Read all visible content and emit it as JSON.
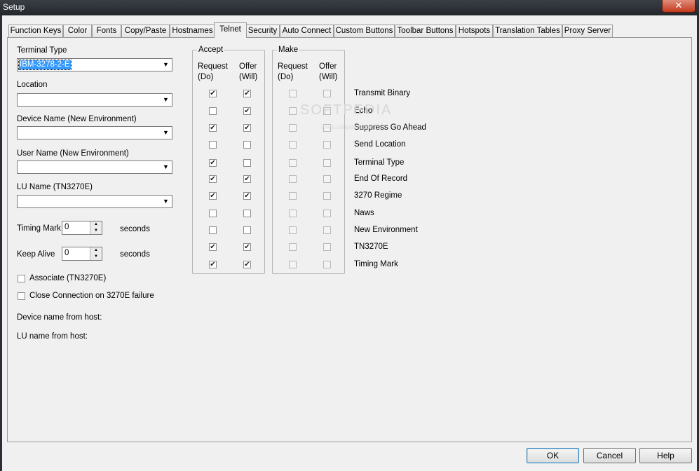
{
  "window": {
    "title": "Setup",
    "close_glyph": "✕"
  },
  "tabs": [
    {
      "label": "Function Keys"
    },
    {
      "label": "Color"
    },
    {
      "label": "Fonts"
    },
    {
      "label": "Copy/Paste"
    },
    {
      "label": "Hostnames"
    },
    {
      "label": "Telnet",
      "active": true
    },
    {
      "label": "Security"
    },
    {
      "label": "Auto Connect"
    },
    {
      "label": "Custom Buttons"
    },
    {
      "label": "Toolbar Buttons"
    },
    {
      "label": "Hotspots"
    },
    {
      "label": "Translation Tables"
    },
    {
      "label": "Proxy Server"
    }
  ],
  "left_form": {
    "terminal_type": {
      "label": "Terminal Type",
      "value": "IBM-3278-2-E"
    },
    "location": {
      "label": "Location",
      "value": ""
    },
    "device_name": {
      "label": "Device Name (New Environment)",
      "value": ""
    },
    "user_name": {
      "label": "User Name (New Environment)",
      "value": ""
    },
    "lu_name": {
      "label": "LU Name (TN3270E)",
      "value": ""
    },
    "timing_mark": {
      "label": "Timing Mark",
      "value": "0",
      "unit": "seconds"
    },
    "keep_alive": {
      "label": "Keep Alive",
      "value": "0",
      "unit": "seconds"
    },
    "associate": {
      "label": "Associate (TN3270E)",
      "checked": false
    },
    "close_connection": {
      "label": "Close Connection on 3270E failure",
      "checked": false
    },
    "device_name_from_host": {
      "label": "Device name from host:"
    },
    "lu_name_from_host": {
      "label": "LU name from host:"
    }
  },
  "options": {
    "accept": {
      "title": "Accept",
      "col1_line1": "Request",
      "col1_line2": "(Do)",
      "col2_line1": "Offer",
      "col2_line2": "(Will)"
    },
    "make": {
      "title": "Make",
      "col1_line1": "Request",
      "col1_line2": "(Do)",
      "col2_line1": "Offer",
      "col2_line2": "(Will)"
    },
    "rows": [
      {
        "label": "Transmit Binary",
        "accept_do": true,
        "accept_will": true,
        "make_do": false,
        "make_will": false
      },
      {
        "label": "Echo",
        "accept_do": false,
        "accept_will": true,
        "make_do": false,
        "make_will": false
      },
      {
        "label": "Suppress Go Ahead",
        "accept_do": true,
        "accept_will": true,
        "make_do": false,
        "make_will": false
      },
      {
        "label": "Send Location",
        "accept_do": false,
        "accept_will": false,
        "make_do": false,
        "make_will": false
      },
      {
        "label": "Terminal Type",
        "accept_do": true,
        "accept_will": false,
        "make_do": false,
        "make_will": false
      },
      {
        "label": "End Of Record",
        "accept_do": true,
        "accept_will": true,
        "make_do": false,
        "make_will": false
      },
      {
        "label": "3270 Regime",
        "accept_do": true,
        "accept_will": true,
        "make_do": false,
        "make_will": false
      },
      {
        "label": "Naws",
        "accept_do": false,
        "accept_will": false,
        "make_do": false,
        "make_will": false
      },
      {
        "label": "New Environment",
        "accept_do": false,
        "accept_will": false,
        "make_do": false,
        "make_will": false
      },
      {
        "label": "TN3270E",
        "accept_do": true,
        "accept_will": true,
        "make_do": false,
        "make_will": false
      },
      {
        "label": "Timing Mark",
        "accept_do": true,
        "accept_will": true,
        "make_do": false,
        "make_will": false
      }
    ]
  },
  "watermark": {
    "text": "SOFTPEDIA",
    "sub": "www.softpedia.com"
  },
  "buttons": {
    "ok": "OK",
    "cancel": "Cancel",
    "help": "Help"
  },
  "glyphs": {
    "check": "✔",
    "arrow_down": "▼",
    "spin_up": "▲",
    "spin_down": "▼"
  }
}
